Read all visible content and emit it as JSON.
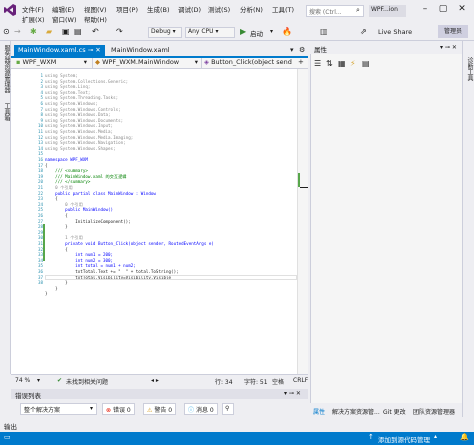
{
  "menu": {
    "row1": [
      "文件(F)",
      "编辑(E)",
      "视图(V)",
      "项目(P)",
      "生成(B)",
      "调试(D)",
      "测试(S)",
      "分析(N)",
      "工具(T)"
    ],
    "row2": [
      "扩展(X)",
      "窗口(W)",
      "帮助(H)"
    ]
  },
  "search": {
    "placeholder": "搜索 (Ctrl..."
  },
  "window_title": "WPF...ion",
  "toolbar": {
    "config": "Debug",
    "platform": "Any CPU",
    "start_label": "启动",
    "live_share": "Live Share",
    "admin": "管理员"
  },
  "left_strip": {
    "items": [
      "服务器资源管理器",
      "工具箱"
    ]
  },
  "tabs": [
    {
      "label": "MainWindow.xaml.cs",
      "active": true
    },
    {
      "label": "MainWindow.xaml",
      "active": false
    }
  ],
  "navbar": {
    "project": "WPF_WXM",
    "class": "WPF_WXM.MainWindow",
    "member": "Button_Click(object send"
  },
  "code": {
    "line_numbers": [
      "1",
      "2",
      "3",
      "4",
      "5",
      "6",
      "7",
      "8",
      "9",
      "10",
      "11",
      "12",
      "13",
      "14",
      "15",
      "16",
      "17",
      "18",
      "19",
      "20",
      "21",
      "22",
      "23",
      "24",
      "25",
      "26",
      "27",
      "28",
      "29",
      "30",
      "31",
      "32",
      "33",
      "34",
      "35",
      "36",
      "37",
      "38"
    ],
    "lines": [
      "using System;",
      "using System.Collections.Generic;",
      "using System.Linq;",
      "using System.Text;",
      "using System.Threading.Tasks;",
      "using System.Windows;",
      "using System.Windows.Controls;",
      "using System.Windows.Data;",
      "using System.Windows.Documents;",
      "using System.Windows.Input;",
      "using System.Windows.Media;",
      "using System.Windows.Media.Imaging;",
      "using System.Windows.Navigation;",
      "using System.Windows.Shapes;",
      "",
      "namespace WPF_WXM",
      "{",
      "    /// <summary>",
      "    /// MainWindow.xaml 的交互逻辑",
      "    /// </summary>",
      "    0 个引用",
      "    public partial class MainWindow : Window",
      "    {",
      "        0 个引用",
      "        public MainWindow()",
      "        {",
      "            InitializeComponent();",
      "        }",
      "",
      "        1 个引用",
      "        private void Button_Click(object sender, RoutedEventArgs e)",
      "        {",
      "            int num1 = 200;",
      "            int num2 = 300;",
      "            int total = num1 + num2;",
      "            txtTotal.Text += \"  \" + total.ToString();",
      "            txtTotal.Visibility=Visibility.Visible",
      "        }",
      "    }",
      "}"
    ]
  },
  "editor_status": {
    "zoom": "74 %",
    "issues": "未找到相关问题",
    "line": "行: 34",
    "char": "字符: 51",
    "space": "空格",
    "eol": "CRLF"
  },
  "error_list": {
    "title": "错误列表",
    "scope": "整个解决方案",
    "errors": "错误 0",
    "warnings": "警告 0",
    "messages": "消息 0"
  },
  "properties": {
    "title": "属性"
  },
  "right_tabs": [
    "属性",
    "解决方案资源管...",
    "Git 更改",
    "团队资源管理器"
  ],
  "right_strip": {
    "label": "诊断工具"
  },
  "output_tab": "输出",
  "bottom": {
    "source_control": "添加到源代码管理"
  },
  "colors": {
    "accent": "#007acc",
    "keyword": "#0000ff",
    "type": "#2b91af",
    "comment": "#008000",
    "string": "#a31515"
  }
}
